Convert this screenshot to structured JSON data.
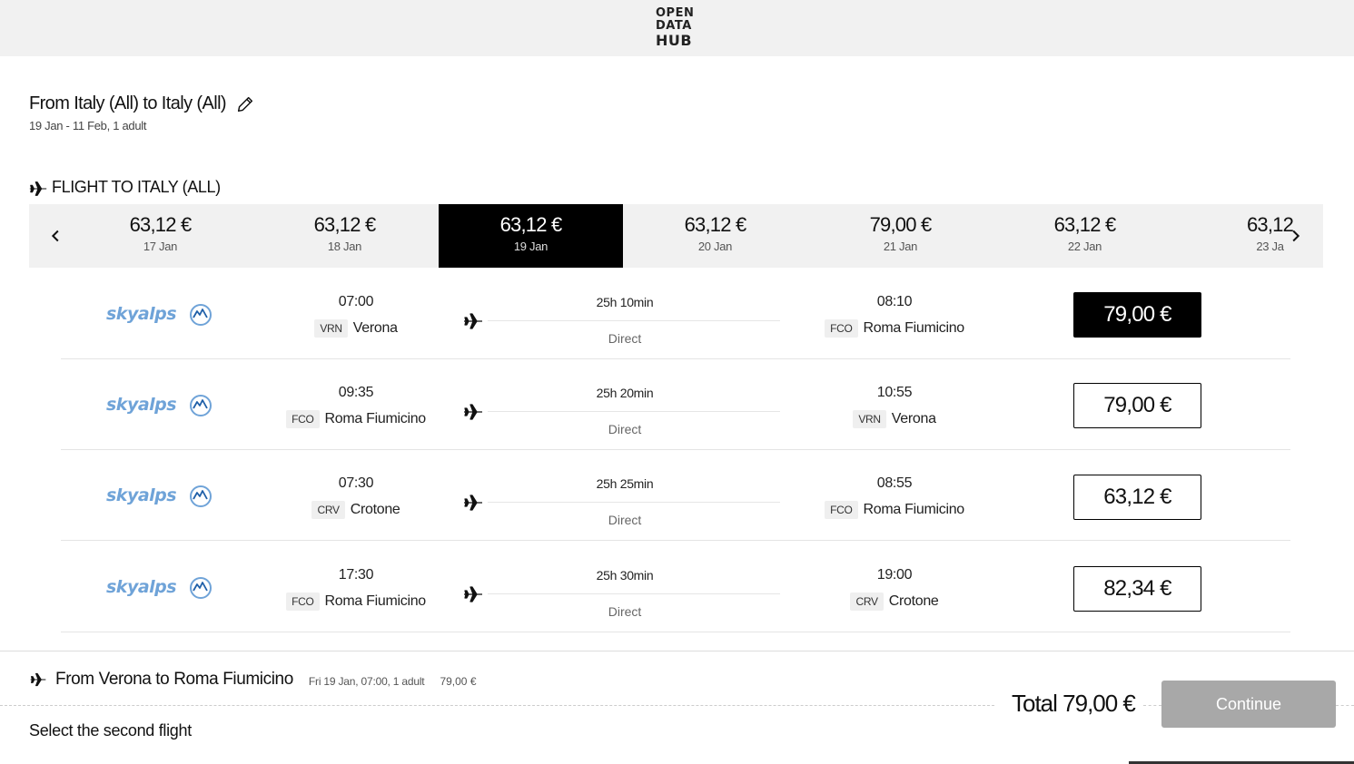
{
  "brand": {
    "line1": "OPEN",
    "line2": "DATA",
    "line3": "HUB"
  },
  "route": {
    "title": "From Italy (All) to Italy (All)",
    "subtitle": "19 Jan - 11 Feb, 1 adult"
  },
  "section": {
    "title": "FLIGHT TO ITALY (ALL)"
  },
  "dates": [
    {
      "price": "63,12 €",
      "day": "17 Jan",
      "active": false
    },
    {
      "price": "63,12 €",
      "day": "18 Jan",
      "active": false
    },
    {
      "price": "63,12 €",
      "day": "19 Jan",
      "active": true
    },
    {
      "price": "63,12 €",
      "day": "20 Jan",
      "active": false
    },
    {
      "price": "79,00 €",
      "day": "21 Jan",
      "active": false
    },
    {
      "price": "63,12 €",
      "day": "22 Jan",
      "active": false
    },
    {
      "price": "63,12",
      "day": "23 Ja",
      "active": false
    }
  ],
  "flights": [
    {
      "airline": "skyalps",
      "dep_time": "07:00",
      "dep_code": "VRN",
      "dep_city": "Verona",
      "duration": "25h 10min",
      "stops": "Direct",
      "arr_time": "08:10",
      "arr_code": "FCO",
      "arr_city": "Roma Fiumicino",
      "price": "79,00 €",
      "selected": true
    },
    {
      "airline": "skyalps",
      "dep_time": "09:35",
      "dep_code": "FCO",
      "dep_city": "Roma Fiumicino",
      "duration": "25h 20min",
      "stops": "Direct",
      "arr_time": "10:55",
      "arr_code": "VRN",
      "arr_city": "Verona",
      "price": "79,00 €",
      "selected": false
    },
    {
      "airline": "skyalps",
      "dep_time": "07:30",
      "dep_code": "CRV",
      "dep_city": "Crotone",
      "duration": "25h 25min",
      "stops": "Direct",
      "arr_time": "08:55",
      "arr_code": "FCO",
      "arr_city": "Roma Fiumicino",
      "price": "63,12 €",
      "selected": false
    },
    {
      "airline": "skyalps",
      "dep_time": "17:30",
      "dep_code": "FCO",
      "dep_city": "Roma Fiumicino",
      "duration": "25h 30min",
      "stops": "Direct",
      "arr_time": "19:00",
      "arr_code": "CRV",
      "arr_city": "Crotone",
      "price": "82,34 €",
      "selected": false
    }
  ],
  "footer": {
    "selection_title": "From Verona to Roma Fiumicino",
    "selection_meta": "Fri 19 Jan, 07:00, 1 adult",
    "selection_price": "79,00 €",
    "second_prompt": "Select the second flight",
    "total": "Total 79,00 €",
    "continue_label": "Continue"
  },
  "colors": {
    "accent": "#000000",
    "skyalps_blue": "#1f5fa8",
    "skyalps_light": "#6fa3d8",
    "disabled": "#a8a8a8"
  }
}
